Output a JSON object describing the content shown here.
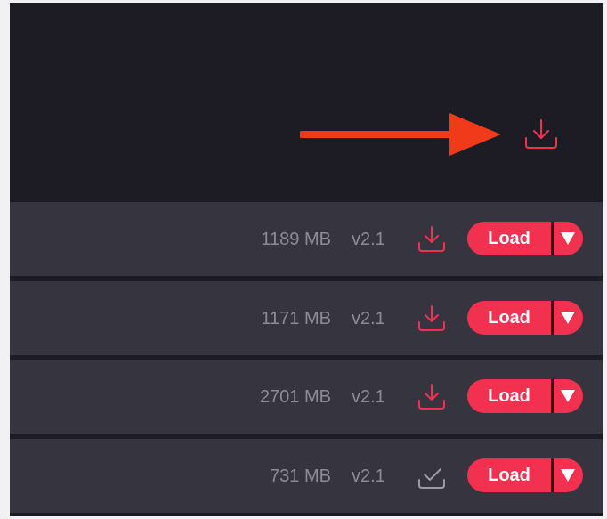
{
  "colors": {
    "accent": "#f2304f",
    "annotation_arrow": "#f03a1a",
    "panel_bg": "#1d1c25",
    "row_bg": "#35343f",
    "muted_text": "#8d8c95",
    "check_icon": "#9c9ba4"
  },
  "header": {
    "download_icon": "download-icon",
    "annotation": "arrow-right"
  },
  "rows": [
    {
      "size": "1189 MB",
      "version": "v2.1",
      "status_icon": "download-icon",
      "load_label": "Load",
      "dropdown_icon": "caret-down-icon"
    },
    {
      "size": "1171 MB",
      "version": "v2.1",
      "status_icon": "download-icon",
      "load_label": "Load",
      "dropdown_icon": "caret-down-icon"
    },
    {
      "size": "2701 MB",
      "version": "v2.1",
      "status_icon": "download-icon",
      "load_label": "Load",
      "dropdown_icon": "caret-down-icon"
    },
    {
      "size": "731 MB",
      "version": "v2.1",
      "status_icon": "check-tray-icon",
      "load_label": "Load",
      "dropdown_icon": "caret-down-icon"
    }
  ]
}
